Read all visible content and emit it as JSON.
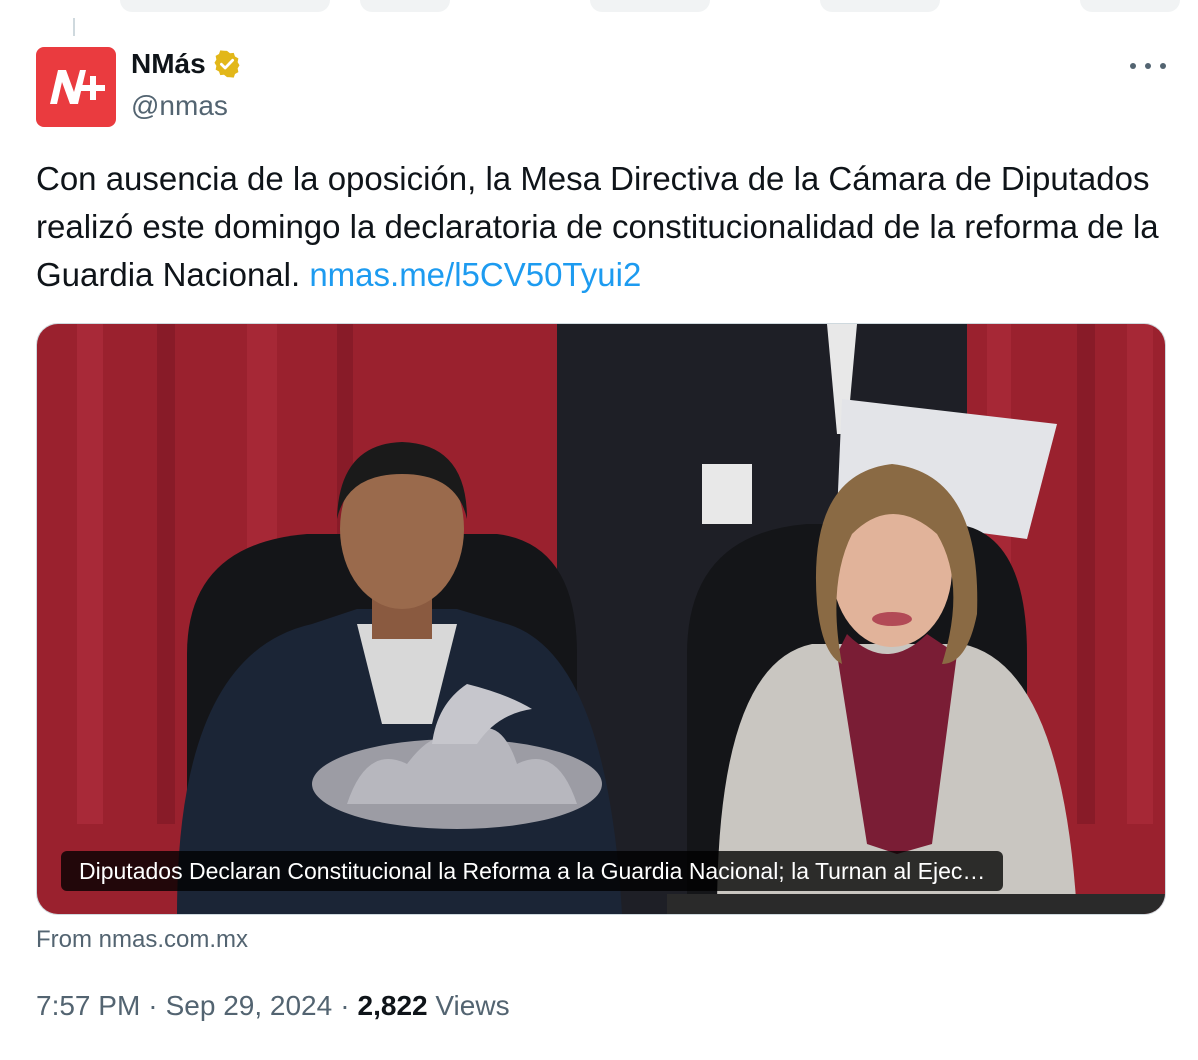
{
  "author": {
    "name": "NMás",
    "handle": "@nmas",
    "avatar_text": "N+",
    "verified": true
  },
  "tweet": {
    "text": "Con ausencia de la oposición, la Mesa Directiva de la Cámara de Diputados realizó este domingo la declaratoria de constitucionalidad de la reforma de la Guardia Nacional. ",
    "link": "nmas.me/l5CV50Tyui2"
  },
  "card": {
    "title": "Diputados Declaran Constitucional la Reforma a la Guardia Nacional; la Turnan al Ejec…",
    "source": "From nmas.com.mx"
  },
  "meta": {
    "time": "7:57 PM",
    "date": "Sep 29, 2024",
    "views_count": "2,822",
    "views_label": "Views"
  },
  "icons": {
    "more": "more-options-icon",
    "verified": "verified-badge-icon"
  },
  "colors": {
    "link": "#1d9bf0",
    "secondary_text": "#536471",
    "avatar_bg": "#ea3b3f",
    "verified_badge": "#e2b719"
  }
}
